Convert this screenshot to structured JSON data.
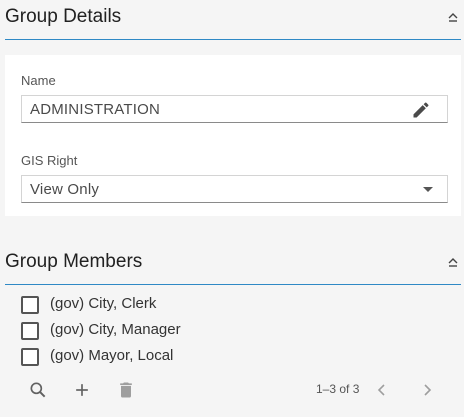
{
  "group_details": {
    "title": "Group Details",
    "name_label": "Name",
    "name_value": "ADMINISTRATION",
    "gis_right_label": "GIS Right",
    "gis_right_value": "View Only"
  },
  "group_members": {
    "title": "Group Members",
    "members": [
      {
        "label": "(gov) City, Clerk",
        "checked": false
      },
      {
        "label": "(gov) City, Manager",
        "checked": false
      },
      {
        "label": "(gov) Mayor, Local",
        "checked": false
      }
    ],
    "pager_text": "1–3 of 3"
  },
  "colors": {
    "accent_rule": "#2f89c5",
    "background": "#f5f5f5",
    "card": "#ffffff"
  },
  "icons": [
    "collapse-icon",
    "edit-icon",
    "dropdown-arrow-icon",
    "search-icon",
    "add-icon",
    "delete-icon",
    "chevron-left-icon",
    "chevron-right-icon"
  ]
}
